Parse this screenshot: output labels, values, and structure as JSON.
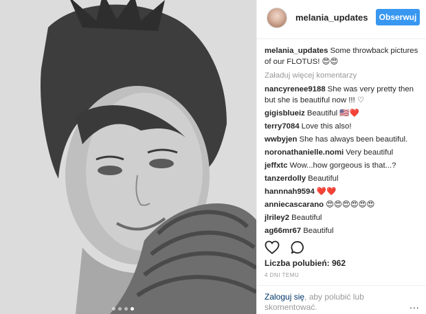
{
  "post": {
    "username": "melania_updates",
    "follow_label": "Obserwuj",
    "caption_user": "melania_updates",
    "caption_text": "Some throwback pictures of our FLOTUS! 😍😍",
    "load_more": "Załaduj więcej komentarzy",
    "likes_text": "Liczba polubień: 962",
    "time_ago": "4 DNI TEMU"
  },
  "comments": [
    {
      "user": "nancyrenee9188",
      "text": "She was very pretty then but she is beautiful now !!! ♡"
    },
    {
      "user": "gigisblueiz",
      "text": "Beautiful 🇺🇸❤️"
    },
    {
      "user": "terry7084",
      "text": "Love this also!"
    },
    {
      "user": "wwbyjen",
      "text": "She has always been beautiful."
    },
    {
      "user": "noronathanielle.nomi",
      "text": "Very beautiful"
    },
    {
      "user": "jeffxtc",
      "text": "Wow...how gorgeous is that...?"
    },
    {
      "user": "tanzerdolly",
      "text": "Beautiful"
    },
    {
      "user": "hannnah9594",
      "text": "❤️❤️"
    },
    {
      "user": "anniecascarano",
      "text": "😍😍😍😍😍😍"
    },
    {
      "user": "jlriley2",
      "text": "Beautiful"
    },
    {
      "user": "ag66mr67",
      "text": "Beautiful"
    }
  ],
  "footer": {
    "login_link": "Zaloguj się",
    "login_rest": ", aby polubić lub skomentować.",
    "more": "..."
  },
  "icons": {
    "like": "heart-icon",
    "comment": "comment-bubble-icon",
    "more": "more-options-icon"
  },
  "colors": {
    "accent": "#3897f0",
    "link": "#003569",
    "muted": "#999999"
  },
  "carousel": {
    "count": 4,
    "active": 4
  }
}
